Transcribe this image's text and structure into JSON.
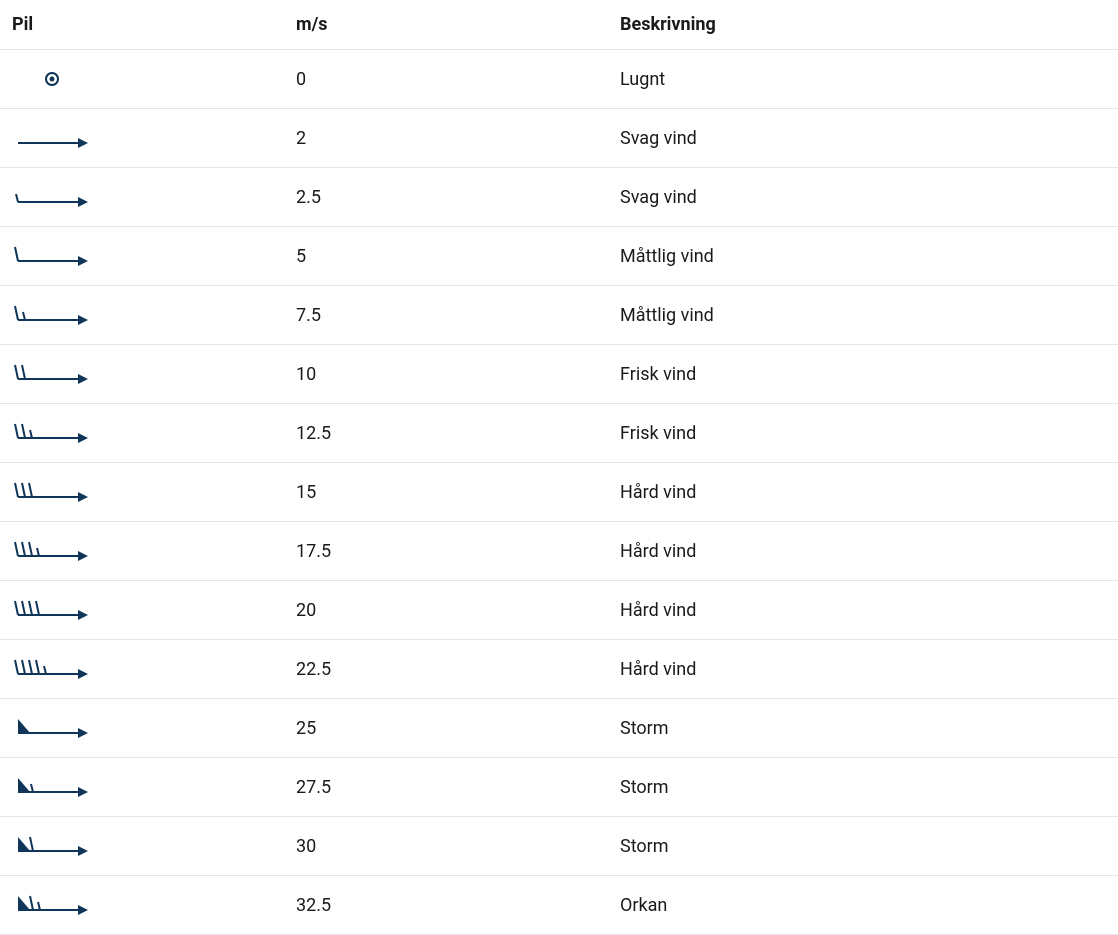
{
  "headers": {
    "pil": "Pil",
    "ms": "m/s",
    "desc": "Beskrivning"
  },
  "rows": [
    {
      "speed": "0",
      "description": "Lugnt",
      "calm": true,
      "half": 0,
      "full": 0,
      "pennants": 0
    },
    {
      "speed": "2",
      "description": "Svag vind",
      "calm": false,
      "half": 0,
      "full": 0,
      "pennants": 0
    },
    {
      "speed": "2.5",
      "description": "Svag vind",
      "calm": false,
      "half": 1,
      "full": 0,
      "pennants": 0
    },
    {
      "speed": "5",
      "description": "Måttlig vind",
      "calm": false,
      "half": 0,
      "full": 1,
      "pennants": 0
    },
    {
      "speed": "7.5",
      "description": "Måttlig vind",
      "calm": false,
      "half": 1,
      "full": 1,
      "pennants": 0
    },
    {
      "speed": "10",
      "description": "Frisk vind",
      "calm": false,
      "half": 0,
      "full": 2,
      "pennants": 0
    },
    {
      "speed": "12.5",
      "description": "Frisk vind",
      "calm": false,
      "half": 1,
      "full": 2,
      "pennants": 0
    },
    {
      "speed": "15",
      "description": "Hård vind",
      "calm": false,
      "half": 0,
      "full": 3,
      "pennants": 0
    },
    {
      "speed": "17.5",
      "description": "Hård vind",
      "calm": false,
      "half": 1,
      "full": 3,
      "pennants": 0
    },
    {
      "speed": "20",
      "description": "Hård vind",
      "calm": false,
      "half": 0,
      "full": 4,
      "pennants": 0
    },
    {
      "speed": "22.5",
      "description": "Hård vind",
      "calm": false,
      "half": 1,
      "full": 4,
      "pennants": 0
    },
    {
      "speed": "25",
      "description": "Storm",
      "calm": false,
      "half": 0,
      "full": 0,
      "pennants": 1
    },
    {
      "speed": "27.5",
      "description": "Storm",
      "calm": false,
      "half": 1,
      "full": 0,
      "pennants": 1
    },
    {
      "speed": "30",
      "description": "Storm",
      "calm": false,
      "half": 0,
      "full": 1,
      "pennants": 1
    },
    {
      "speed": "32.5",
      "description": "Orkan",
      "calm": false,
      "half": 1,
      "full": 1,
      "pennants": 1
    }
  ],
  "chart_data": {
    "type": "table",
    "title": "Wind arrow legend",
    "columns": [
      "m/s",
      "Beskrivning"
    ],
    "rows": [
      [
        0,
        "Lugnt"
      ],
      [
        2,
        "Svag vind"
      ],
      [
        2.5,
        "Svag vind"
      ],
      [
        5,
        "Måttlig vind"
      ],
      [
        7.5,
        "Måttlig vind"
      ],
      [
        10,
        "Frisk vind"
      ],
      [
        12.5,
        "Frisk vind"
      ],
      [
        15,
        "Hård vind"
      ],
      [
        17.5,
        "Hård vind"
      ],
      [
        20,
        "Hård vind"
      ],
      [
        22.5,
        "Hård vind"
      ],
      [
        25,
        "Storm"
      ],
      [
        27.5,
        "Storm"
      ],
      [
        30,
        "Storm"
      ],
      [
        32.5,
        "Orkan"
      ]
    ]
  }
}
